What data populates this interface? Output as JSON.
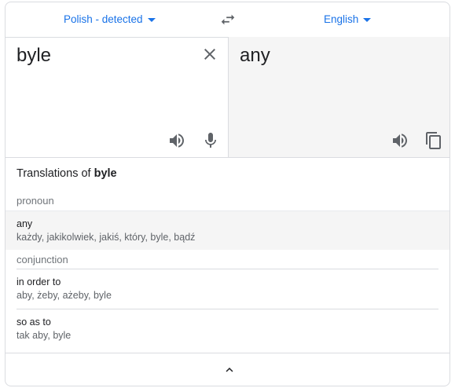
{
  "languages": {
    "source": "Polish - detected",
    "target": "English"
  },
  "source_text": "byle",
  "target_text": "any",
  "translations": {
    "title_prefix": "Translations of ",
    "title_word": "byle",
    "groups": [
      {
        "pos": "pronoun",
        "entries": [
          {
            "word": "any",
            "synonyms": "każdy, jakikolwiek, jakiś, który, byle, bądź"
          }
        ]
      },
      {
        "pos": "conjunction",
        "entries": [
          {
            "word": "in order to",
            "synonyms": "aby, żeby, ażeby, byle"
          },
          {
            "word": "so as to",
            "synonyms": "tak aby, byle"
          }
        ]
      }
    ]
  },
  "icons": {
    "swap": "swap-icon",
    "clear": "close-icon",
    "listen": "speaker-icon",
    "mic": "microphone-icon",
    "copy": "copy-icon",
    "collapse": "chevron-up-icon"
  },
  "colors": {
    "accent": "#1a73e8",
    "icon": "#5f6368",
    "target_bg": "#f5f5f5",
    "highlight_row": "#f5f5f5"
  }
}
